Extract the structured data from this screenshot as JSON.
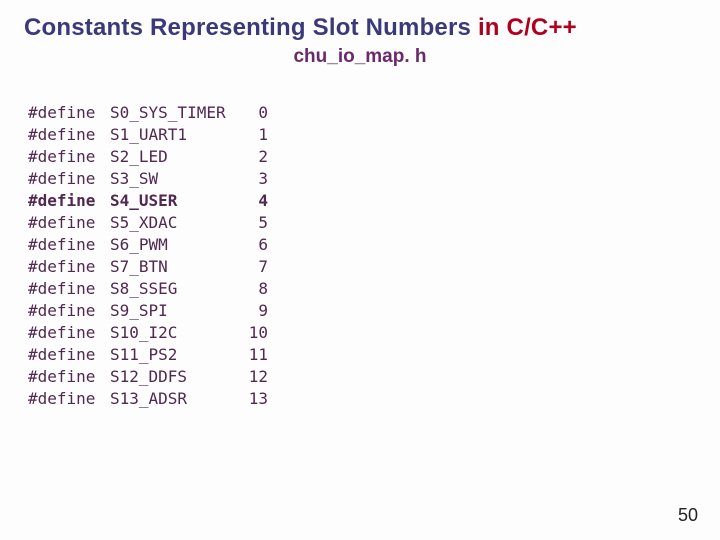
{
  "title": {
    "plain": "Constants Representing Slot Numbers ",
    "accent": "in C/C++"
  },
  "subtitle": "chu_io_map. h",
  "page_number": "50",
  "code": {
    "keyword": "#define",
    "rows": [
      {
        "name": "S0_SYS_TIMER",
        "value": "0",
        "bold": false
      },
      {
        "name": "S1_UART1",
        "value": "1",
        "bold": false
      },
      {
        "name": "S2_LED",
        "value": "2",
        "bold": false
      },
      {
        "name": "S3_SW",
        "value": "3",
        "bold": false
      },
      {
        "name": "S4_USER",
        "value": "4",
        "bold": true
      },
      {
        "name": "S5_XDAC",
        "value": "5",
        "bold": false
      },
      {
        "name": "S6_PWM",
        "value": "6",
        "bold": false
      },
      {
        "name": "S7_BTN",
        "value": "7",
        "bold": false
      },
      {
        "name": "S8_SSEG",
        "value": "8",
        "bold": false
      },
      {
        "name": "S9_SPI",
        "value": "9",
        "bold": false
      },
      {
        "name": "S10_I2C",
        "value": "10",
        "bold": false
      },
      {
        "name": "S11_PS2",
        "value": "11",
        "bold": false
      },
      {
        "name": "S12_DDFS",
        "value": "12",
        "bold": false
      },
      {
        "name": "S13_ADSR",
        "value": "13",
        "bold": false
      }
    ]
  }
}
